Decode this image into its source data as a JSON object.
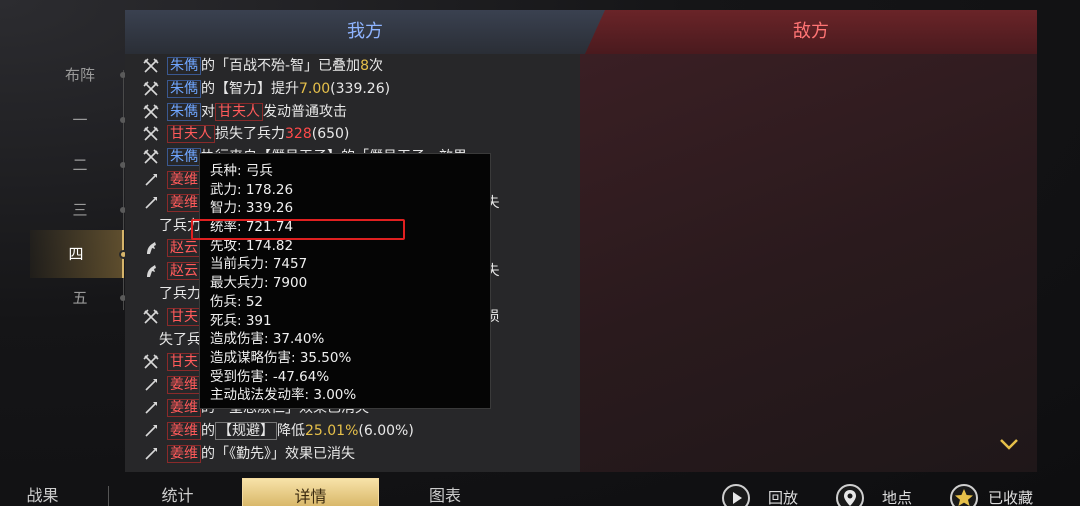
{
  "rail": {
    "formation_label": "布阵",
    "rounds": [
      "一",
      "二",
      "三",
      "四",
      "五"
    ],
    "active_round": "四"
  },
  "tabs": {
    "mine": "我方",
    "enemy": "敌方"
  },
  "log": [
    {
      "icon": "crossed-swords-icon",
      "parts": [
        [
          "blue",
          "朱儁"
        ],
        [
          "n",
          "的「百战不殆-智」已叠加"
        ],
        [
          "gold",
          "8"
        ],
        [
          "n",
          "次"
        ]
      ]
    },
    {
      "icon": "crossed-swords-icon",
      "parts": [
        [
          "blue",
          "朱儁"
        ],
        [
          "n",
          "的"
        ],
        [
          "n",
          "【智力】"
        ],
        [
          "n",
          "提升"
        ],
        [
          "gold",
          "7.00"
        ],
        [
          "n",
          "(339.26)"
        ]
      ]
    },
    {
      "icon": "crossed-swords-icon",
      "parts": [
        [
          "blue",
          "朱儁"
        ],
        [
          "n",
          "对"
        ],
        [
          "red",
          "甘夫人"
        ],
        [
          "n",
          "发动普通攻击"
        ]
      ]
    },
    {
      "icon": "crossed-swords-icon",
      "parts": [
        [
          "red",
          "甘夫人"
        ],
        [
          "n",
          "损失了兵力"
        ],
        [
          "redn",
          "328"
        ],
        [
          "n",
          "(650)"
        ]
      ]
    },
    {
      "icon": "crossed-swords-icon",
      "parts": [
        [
          "blue",
          "朱儁"
        ],
        [
          "n",
          "执行来自【僭号天子】的「僭号天子」效果"
        ]
      ]
    },
    {
      "icon": "spear-icon",
      "parts": [
        [
          "red",
          "姜维"
        ],
        [
          "n",
          ""
        ]
      ]
    },
    {
      "icon": "spear-icon",
      "parts": [
        [
          "red",
          "姜维"
        ],
        [
          "n",
          "执行来自【僭号天子】的「僭号天子」效果,损失"
        ]
      ]
    },
    {
      "icon": "none",
      "parts": [
        [
          "n",
          "了兵力"
        ]
      ]
    },
    {
      "icon": "horse-icon",
      "parts": [
        [
          "red",
          "赵云"
        ],
        [
          "n",
          ""
        ]
      ]
    },
    {
      "icon": "horse-icon",
      "parts": [
        [
          "red",
          "赵云"
        ],
        [
          "n",
          "执行来自【僭号天子】的「僭号天子」效果,损失"
        ]
      ]
    },
    {
      "icon": "none",
      "parts": [
        [
          "n",
          "了兵力"
        ]
      ]
    },
    {
      "icon": "crossed-swords-icon",
      "parts": [
        [
          "red",
          "甘夫人"
        ],
        [
          "n",
          "执行来自【僭号天子】的「僭号天子」效果,损"
        ]
      ]
    },
    {
      "icon": "none",
      "parts": [
        [
          "n",
          "失了兵力"
        ]
      ]
    },
    {
      "icon": "crossed-swords-icon",
      "parts": [
        [
          "red",
          "甘夫人"
        ],
        [
          "n",
          ""
        ]
      ]
    },
    {
      "icon": "spear-icon",
      "parts": [
        [
          "red",
          "姜维"
        ],
        [
          "n",
          "的「...」效果已消失"
        ]
      ]
    },
    {
      "icon": "spear-icon",
      "parts": [
        [
          "red",
          "姜维"
        ],
        [
          "n",
          "的「皇思淑仁」效果已消失"
        ]
      ]
    },
    {
      "icon": "spear-icon",
      "parts": [
        [
          "red",
          "姜维"
        ],
        [
          "n",
          "的"
        ],
        [
          "box",
          "【规避】"
        ],
        [
          "n",
          "降低"
        ],
        [
          "gold",
          "25.01%"
        ],
        [
          "n",
          "(6.00%)"
        ]
      ]
    },
    {
      "icon": "spear-icon",
      "parts": [
        [
          "red",
          "姜维"
        ],
        [
          "n",
          "的「《勤先》」效果已消失"
        ]
      ]
    }
  ],
  "tooltip": [
    "兵种: 弓兵",
    "武力: 178.26",
    "智力: 339.26",
    "统率: 721.74",
    "先攻: 174.82",
    "当前兵力: 7457",
    "最大兵力: 7900",
    "伤兵: 52",
    "死兵: 391",
    "造成伤害: 37.40%",
    "造成谋略伤害: 35.50%",
    "受到伤害: -47.64%",
    "主动战法发动率: 3.00%"
  ],
  "bottom": {
    "tabs": [
      "战果",
      "统计",
      "详情",
      "图表"
    ],
    "active_tab": "详情",
    "actions": [
      {
        "icon": "play-icon",
        "label": "回放"
      },
      {
        "icon": "location-pin-icon",
        "label": "地点"
      },
      {
        "icon": "star-icon",
        "label": "已收藏"
      }
    ]
  },
  "colors": {
    "ally": "#6fa6ff",
    "enemy": "#ff5a5a",
    "gold": "#e6c04a",
    "highlight": "#e02020"
  }
}
